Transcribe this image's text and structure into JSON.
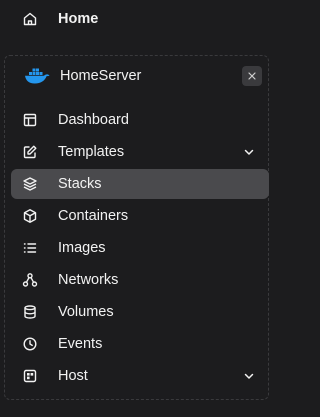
{
  "home": {
    "label": "Home",
    "icon": "home-icon"
  },
  "environment": {
    "name": "HomeServer",
    "logo_icon": "docker-whale-icon",
    "close_icon": "close-icon",
    "logo_color": "#2496ed"
  },
  "nav": {
    "items": [
      {
        "label": "Dashboard",
        "icon": "dashboard-icon",
        "active": false,
        "expandable": false
      },
      {
        "label": "Templates",
        "icon": "edit-icon",
        "active": false,
        "expandable": true
      },
      {
        "label": "Stacks",
        "icon": "layers-icon",
        "active": true,
        "expandable": false
      },
      {
        "label": "Containers",
        "icon": "box-icon",
        "active": false,
        "expandable": false
      },
      {
        "label": "Images",
        "icon": "list-icon",
        "active": false,
        "expandable": false
      },
      {
        "label": "Networks",
        "icon": "network-icon",
        "active": false,
        "expandable": false
      },
      {
        "label": "Volumes",
        "icon": "database-icon",
        "active": false,
        "expandable": false
      },
      {
        "label": "Events",
        "icon": "clock-icon",
        "active": false,
        "expandable": false
      },
      {
        "label": "Host",
        "icon": "host-icon",
        "active": false,
        "expandable": true
      }
    ]
  },
  "colors": {
    "background": "#1c1c1e",
    "active_item": "#4a4a4d",
    "text": "#f2f2f2",
    "panel_border": "#3a3a3d"
  }
}
